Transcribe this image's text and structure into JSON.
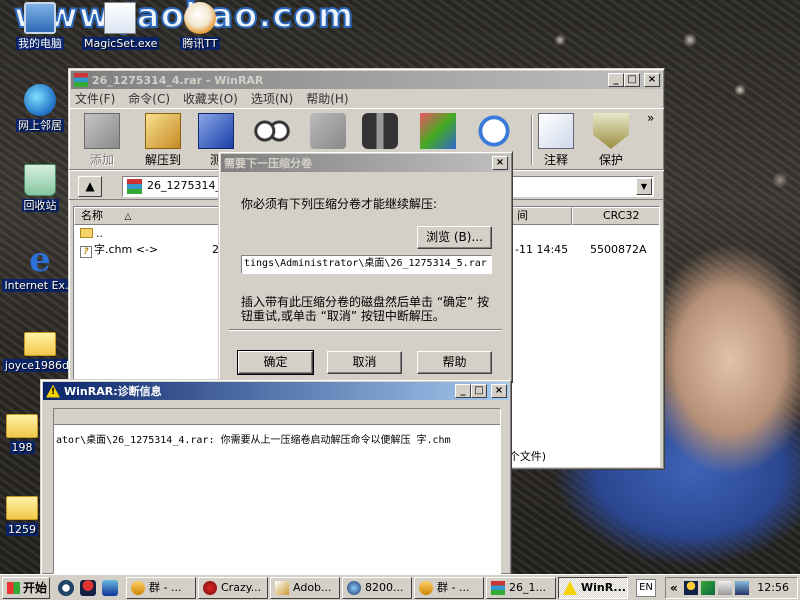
{
  "desktop": {
    "watermark": "www.Jaohao.com",
    "icons": [
      {
        "label": "我的电脑"
      },
      {
        "label": "MagicSet.exe"
      },
      {
        "label": "腾讯TT"
      },
      {
        "label": "网上邻居"
      },
      {
        "label": "回收站"
      },
      {
        "label": "Internet Ex..."
      },
      {
        "label": "joyce1986dc"
      },
      {
        "label": "198"
      },
      {
        "label": "1259"
      }
    ]
  },
  "winrar": {
    "title": "26_1275314_4.rar - WinRAR",
    "menu": [
      "文件(F)",
      "命令(C)",
      "收藏夹(O)",
      "选项(N)",
      "帮助(H)"
    ],
    "toolbar": [
      {
        "label": "添加",
        "icon": "add-archive-icon",
        "enabled": false
      },
      {
        "label": "解压到",
        "icon": "extract-to-icon",
        "enabled": true
      },
      {
        "label": "测",
        "icon": "test-icon",
        "enabled": true
      },
      {
        "label": "",
        "icon": "view-icon",
        "enabled": true
      },
      {
        "label": "",
        "icon": "delete-icon",
        "enabled": true
      },
      {
        "label": "",
        "icon": "find-icon",
        "enabled": true
      },
      {
        "label": "",
        "icon": "wizard-icon",
        "enabled": true
      },
      {
        "label": "",
        "icon": "info-icon",
        "enabled": true
      },
      {
        "label": "注释",
        "icon": "comment-icon",
        "enabled": true
      },
      {
        "label": "保护",
        "icon": "protect-icon",
        "enabled": true
      }
    ],
    "toolbar_more": "»",
    "address": "26_1275314_4",
    "columns": {
      "name": "名称",
      "modified": "间",
      "crc": "CRC32"
    },
    "rows": [
      {
        "name": "..",
        "size": "",
        "modified": "",
        "crc": ""
      },
      {
        "name": "字.chm <->",
        "size": "2",
        "modified": "-11 14:45",
        "crc": "5500872A"
      }
    ],
    "status": "个文件)"
  },
  "volume_dialog": {
    "title": "需要下一压缩分卷",
    "prompt": "你必须有下列压缩分卷才能继续解压:",
    "browse_label": "浏览 (B)...",
    "path_value": "tings\\Administrator\\桌面\\26_1275314_5.rar",
    "hint_line1": "插入带有此压缩分卷的磁盘然后单击 “确定” 按",
    "hint_line2": "钮重试,或单击 “取消” 按钮中断解压。",
    "ok_label": "确定",
    "cancel_label": "取消",
    "help_label": "帮助"
  },
  "diag": {
    "title": "WinRAR:诊断信息",
    "message": "ator\\桌面\\26_1275314_4.rar: 你需要从上一压缩卷启动解压命令以便解压 字.chm"
  },
  "taskbar": {
    "start_label": "开始",
    "tasks": [
      {
        "label": "群 - ..."
      },
      {
        "label": "Crazy..."
      },
      {
        "label": "Adob..."
      },
      {
        "label": "8200..."
      },
      {
        "label": "群 - ..."
      },
      {
        "label": "26_1..."
      },
      {
        "label": "WinR..."
      }
    ],
    "lang": "EN",
    "tray_chevron": "«",
    "clock": "12:56"
  },
  "colors": {
    "active_title_start": "#0a246a",
    "active_title_end": "#a6caf0",
    "inactive_title_start": "#808080",
    "face": "#d4d0c8"
  }
}
